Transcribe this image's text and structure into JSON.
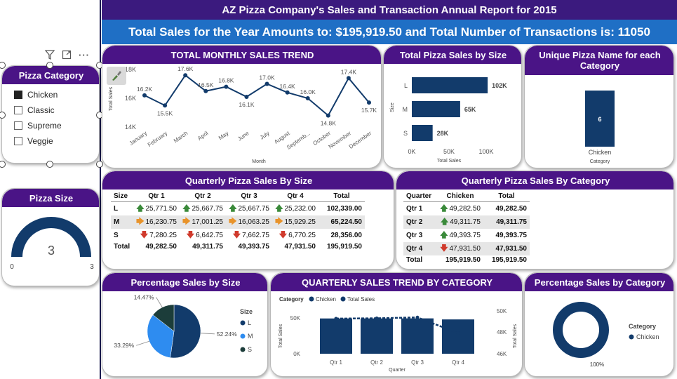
{
  "header": {
    "title": "AZ Pizza Company's Sales and Transaction Annual Report for 2015",
    "subtitle": "Total Sales for the Year Amounts to: $195,919.50 and Total Number of Transactions is: 11050"
  },
  "category_slicer": {
    "title": "Pizza Category",
    "items": [
      {
        "label": "Chicken",
        "checked": true
      },
      {
        "label": "Classic",
        "checked": false
      },
      {
        "label": "Supreme",
        "checked": false
      },
      {
        "label": "Veggie",
        "checked": false
      }
    ]
  },
  "pizza_size_gauge": {
    "title": "Pizza Size",
    "value": "3",
    "min": "0",
    "max": "3",
    "fraction": 1.0
  },
  "monthly_trend": {
    "title": "TOTAL MONTHLY SALES TREND",
    "xlabel": "Month",
    "ylabel": "Total Sales",
    "yticks": [
      "18K",
      "16K",
      "14K"
    ]
  },
  "size_bar": {
    "title": "Total Pizza Sales by Size",
    "ylabel": "Size",
    "xlabel": "Total Sales",
    "xticks": [
      "0K",
      "50K",
      "100K"
    ]
  },
  "unique_names": {
    "title": "Unique Pizza Name for each Category",
    "value_label": "6",
    "category": "Chicken",
    "axis_label": "Category"
  },
  "quarterly_size": {
    "title": "Quarterly Pizza Sales By Size",
    "columns": [
      "Size",
      "Qtr 1",
      "Qtr 2",
      "Qtr 3",
      "Qtr 4",
      "Total"
    ],
    "rows": [
      {
        "label": "L",
        "cells": [
          {
            "v": "25,771.50",
            "a": "up"
          },
          {
            "v": "25,667.75",
            "a": "up"
          },
          {
            "v": "25,667.75",
            "a": "up"
          },
          {
            "v": "25,232.00",
            "a": "up"
          }
        ],
        "total": "102,339.00"
      },
      {
        "label": "M",
        "cells": [
          {
            "v": "16,230.75",
            "a": "side"
          },
          {
            "v": "17,001.25",
            "a": "side"
          },
          {
            "v": "16,063.25",
            "a": "side"
          },
          {
            "v": "15,929.25",
            "a": "side"
          }
        ],
        "total": "65,224.50"
      },
      {
        "label": "S",
        "cells": [
          {
            "v": "7,280.25",
            "a": "down"
          },
          {
            "v": "6,642.75",
            "a": "down"
          },
          {
            "v": "7,662.75",
            "a": "down"
          },
          {
            "v": "6,770.25",
            "a": "down"
          }
        ],
        "total": "28,356.00"
      }
    ],
    "total_row": {
      "label": "Total",
      "values": [
        "49,282.50",
        "49,311.75",
        "49,393.75",
        "47,931.50",
        "195,919.50"
      ]
    }
  },
  "quarterly_category": {
    "title": "Quarterly Pizza Sales By Category",
    "columns": [
      "Quarter",
      "Chicken",
      "Total"
    ],
    "rows": [
      {
        "label": "Qtr 1",
        "v": "49,282.50",
        "a": "up",
        "total": "49,282.50"
      },
      {
        "label": "Qtr 2",
        "v": "49,311.75",
        "a": "up",
        "total": "49,311.75"
      },
      {
        "label": "Qtr 3",
        "v": "49,393.75",
        "a": "up",
        "total": "49,393.75"
      },
      {
        "label": "Qtr 4",
        "v": "47,931.50",
        "a": "down",
        "total": "47,931.50"
      }
    ],
    "total_row": {
      "label": "Total",
      "values": [
        "195,919.50",
        "195,919.50"
      ]
    }
  },
  "pct_size": {
    "title": "Percentage Sales by Size",
    "legend_title": "Size"
  },
  "quarterly_trend": {
    "title": "QUARTERLY SALES TREND BY CATEGORY",
    "legend_title": "Category",
    "legend_items": [
      "Chicken",
      "Total Sales"
    ],
    "xlabel": "Quarter",
    "ylabel_left": "Total Sales",
    "ylabel_right": "Total Sales",
    "left_ticks": [
      "50K",
      "0K"
    ],
    "right_ticks": [
      "50K",
      "48K",
      "46K"
    ]
  },
  "pct_category": {
    "title": "Percentage Sales by Category",
    "legend_title": "Category",
    "legend_item": "Chicken",
    "label": "100%"
  },
  "colors": {
    "header_purple": "#3b1a7e",
    "subtitle_blue": "#1f6fc5",
    "navy": "#123b6b",
    "blue": "#2e8cf0",
    "dark_green": "#1c3d3a"
  },
  "chart_data": [
    {
      "type": "line",
      "title": "TOTAL MONTHLY SALES TREND",
      "xlabel": "Month",
      "ylabel": "Total Sales",
      "categories": [
        "January",
        "February",
        "March",
        "April",
        "May",
        "June",
        "July",
        "August",
        "September",
        "October",
        "November",
        "December"
      ],
      "values": [
        16.2,
        15.5,
        17.6,
        16.5,
        16.8,
        16.1,
        17.0,
        16.4,
        16.0,
        14.8,
        17.4,
        15.7
      ],
      "labels": [
        "16.2K",
        "15.5K",
        "17.6K",
        "16.5K",
        "16.8K",
        "16.1K",
        "17.0K",
        "16.4K",
        "16.0K",
        "14.8K",
        "17.4K",
        "15.7K"
      ],
      "units": "thousands",
      "ylim": [
        14,
        18
      ]
    },
    {
      "type": "bar",
      "title": "Total Pizza Sales by Size",
      "orientation": "horizontal",
      "categories": [
        "L",
        "M",
        "S"
      ],
      "values": [
        102,
        65,
        28
      ],
      "labels": [
        "102K",
        "65K",
        "28K"
      ],
      "units": "thousands",
      "xlim": [
        0,
        100
      ]
    },
    {
      "type": "bar",
      "title": "Unique Pizza Name for each Category",
      "categories": [
        "Chicken"
      ],
      "values": [
        6
      ],
      "xlabel": "Category"
    },
    {
      "type": "pie",
      "title": "Percentage Sales by Size",
      "categories": [
        "L",
        "M",
        "S"
      ],
      "values": [
        52.24,
        33.29,
        14.47
      ],
      "labels": [
        "52.24%",
        "33.29%",
        "14.47%"
      ],
      "colors": [
        "#123b6b",
        "#2e8cf0",
        "#1c3d3a"
      ]
    },
    {
      "type": "bar",
      "title": "QUARTERLY SALES TREND BY CATEGORY",
      "categories": [
        "Qtr 1",
        "Qtr 2",
        "Qtr 3",
        "Qtr 4"
      ],
      "series": [
        {
          "name": "Chicken",
          "values": [
            49282.5,
            49311.75,
            49393.75,
            47931.5
          ]
        },
        {
          "name": "Total Sales",
          "values": [
            49282.5,
            49311.75,
            49393.75,
            47931.5
          ]
        }
      ],
      "xlabel": "Quarter",
      "ylabel": "Total Sales",
      "ylim_left": [
        0,
        50000
      ],
      "ylim_right": [
        46000,
        50000
      ]
    },
    {
      "type": "pie",
      "title": "Percentage Sales by Category",
      "categories": [
        "Chicken"
      ],
      "values": [
        100
      ],
      "labels": [
        "100%"
      ]
    }
  ]
}
